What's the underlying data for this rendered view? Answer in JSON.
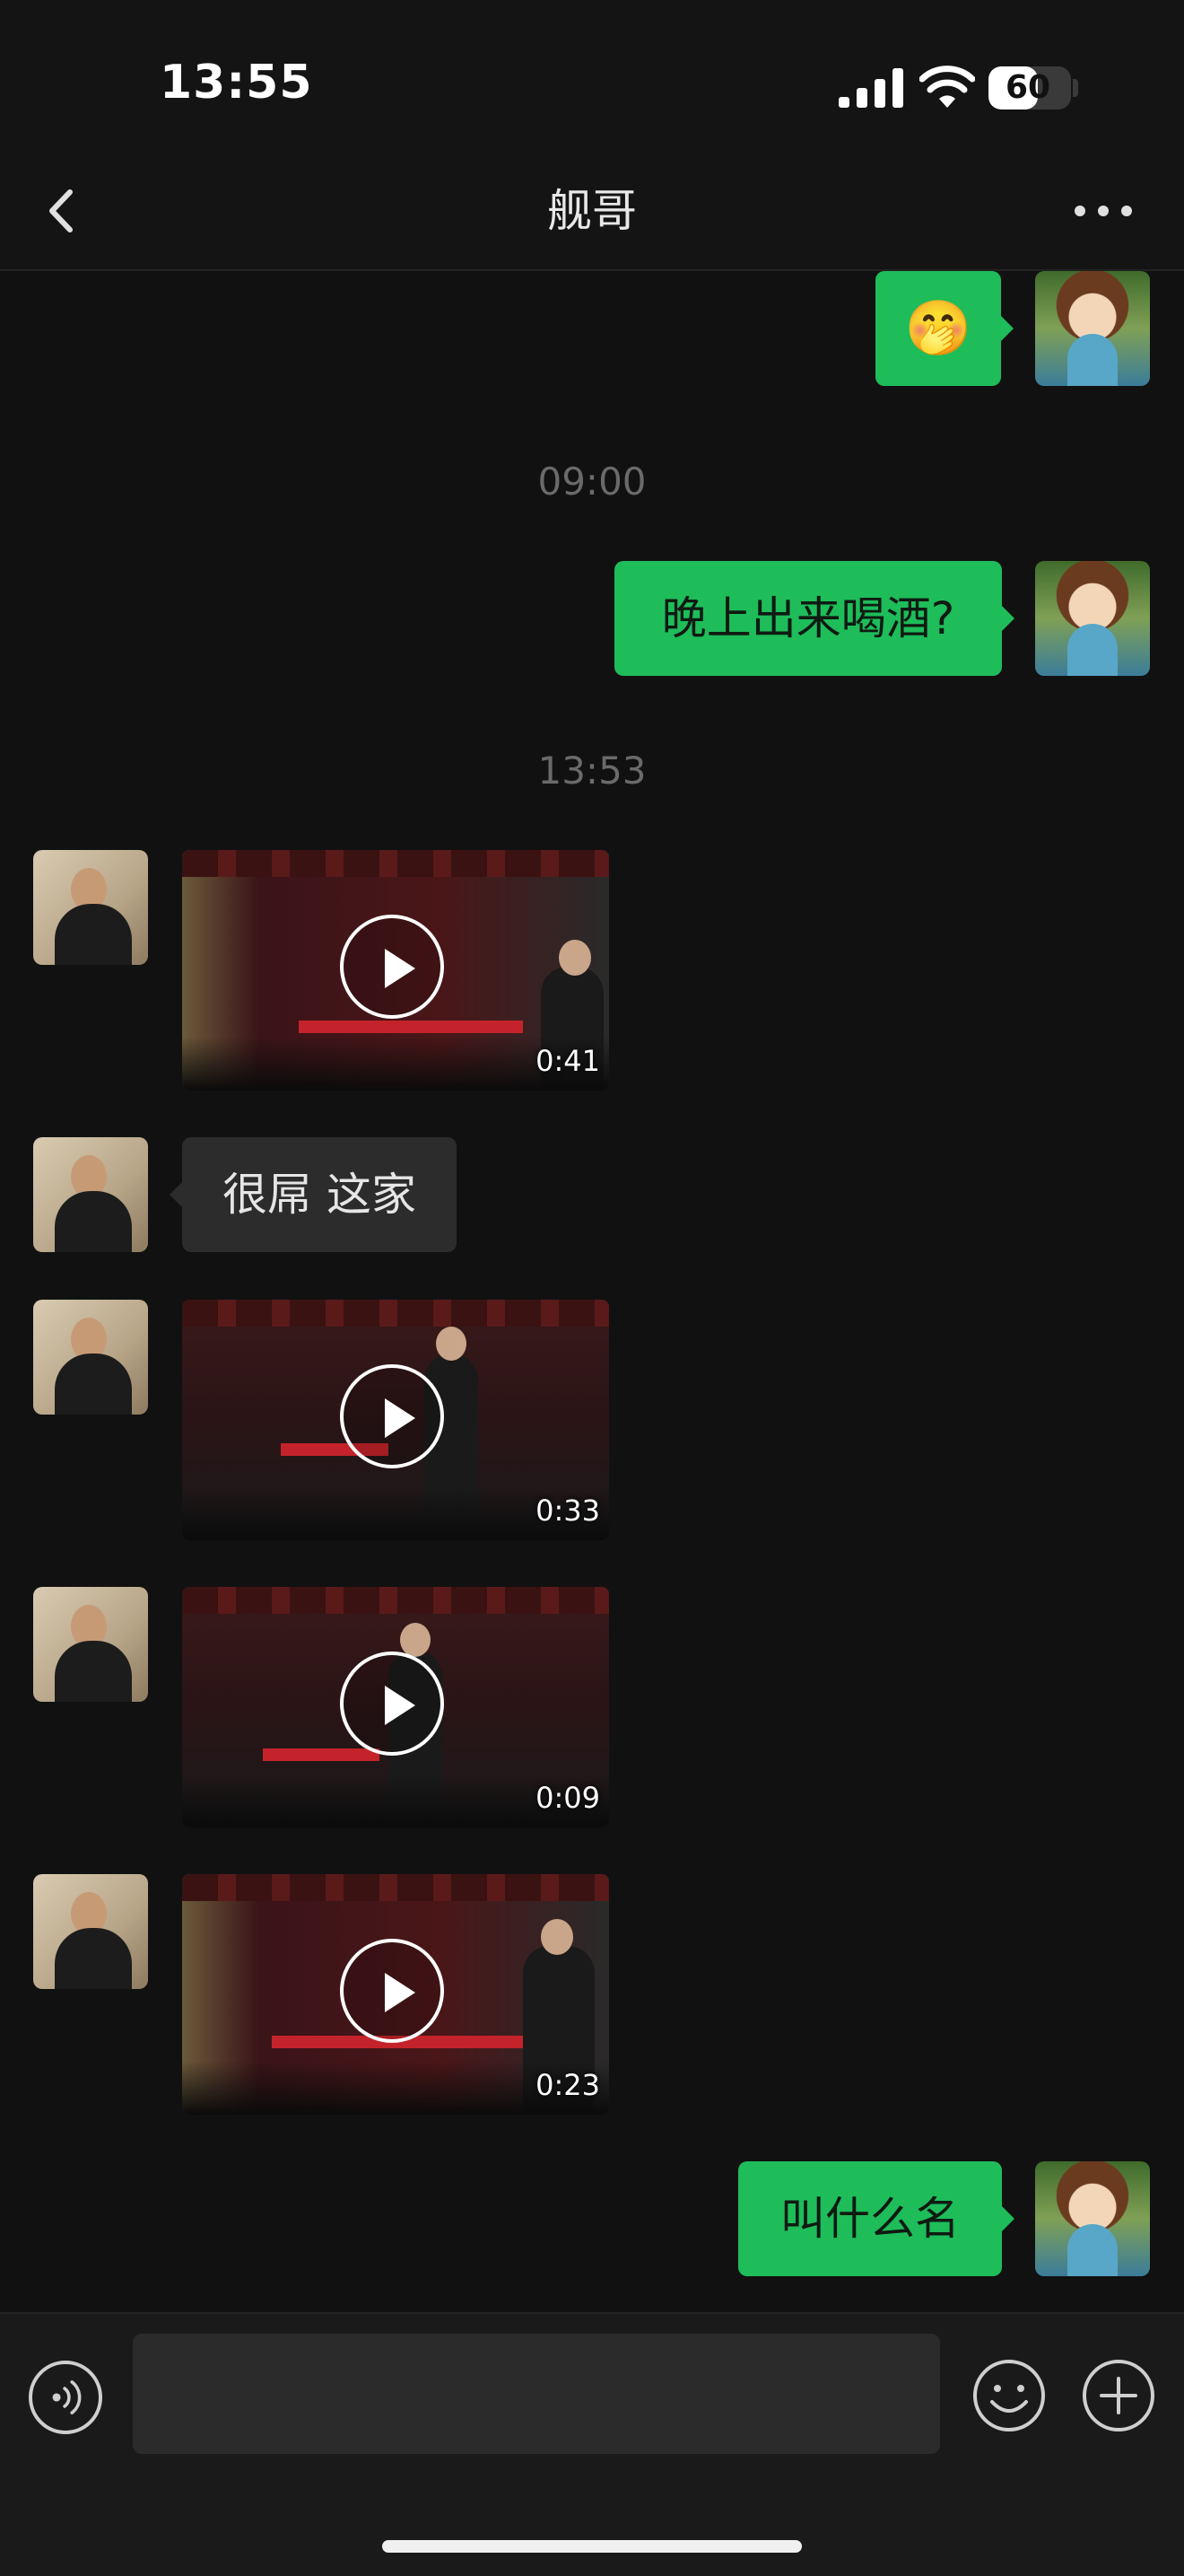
{
  "status_bar": {
    "time": "13:55",
    "battery_level": "60",
    "battery_percent": 60
  },
  "nav": {
    "title": "舰哥",
    "back_icon": "chevron-left-icon",
    "more_icon": "more-dots-icon"
  },
  "messages": [
    {
      "sender": "me",
      "type": "emoji",
      "content": "🤭"
    },
    {
      "type": "timestamp",
      "text": "09:00"
    },
    {
      "sender": "me",
      "type": "text",
      "text": "晚上出来喝酒?"
    },
    {
      "type": "timestamp",
      "text": "13:53"
    },
    {
      "sender": "friend",
      "type": "video",
      "duration": "0:41"
    },
    {
      "sender": "friend",
      "type": "text",
      "text": "很屌 这家"
    },
    {
      "sender": "friend",
      "type": "video",
      "duration": "0:33"
    },
    {
      "sender": "friend",
      "type": "video",
      "duration": "0:09"
    },
    {
      "sender": "friend",
      "type": "video",
      "duration": "0:23"
    },
    {
      "sender": "me",
      "type": "text",
      "text": "叫什么名"
    }
  ],
  "input_bar": {
    "voice_icon": "voice-icon",
    "input_value": "",
    "emoji_icon": "emoji-icon",
    "plus_icon": "plus-icon"
  },
  "colors": {
    "my_bubble": "#1ebd5a",
    "friend_bubble": "#2c2c2c",
    "background": "#111111"
  }
}
